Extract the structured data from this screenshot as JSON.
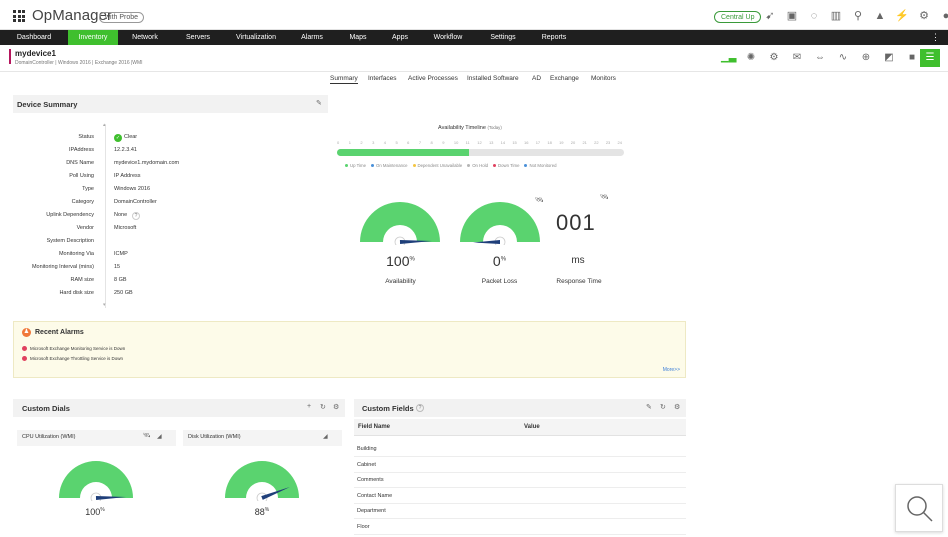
{
  "header": {
    "brand": "OpManager",
    "edition": "with Probe",
    "central_status": "Central Up",
    "icons": [
      "rocket-icon",
      "monitor-icon",
      "lightbulb-icon",
      "gift-icon",
      "search-icon",
      "bell-icon",
      "plug-icon",
      "gear-icon",
      "user-icon"
    ]
  },
  "nav": {
    "items": [
      "Dashboard",
      "Inventory",
      "Network",
      "Servers",
      "Virtualization",
      "Alarms",
      "Maps",
      "Apps",
      "Workflow",
      "Settings",
      "Reports"
    ],
    "active": "Inventory"
  },
  "device": {
    "name": "mydevice1",
    "subtitle": "DomainController | Windows 2016 | Exchange 2016 |WMI"
  },
  "tabs": {
    "items": [
      "Summary",
      "Interfaces",
      "Active Processes",
      "Installed Software",
      "AD",
      "Exchange",
      "Monitors"
    ],
    "active": "Summary"
  },
  "device_summary": {
    "title": "Device Summary",
    "rows": [
      {
        "label": "Status",
        "value": "Clear"
      },
      {
        "label": "IPAddress",
        "value": "12.2.3.41"
      },
      {
        "label": "DNS Name",
        "value": "mydevice1.mydomain.com"
      },
      {
        "label": "Poll Using",
        "value": "IP Address"
      },
      {
        "label": "Type",
        "value": "Windows 2016"
      },
      {
        "label": "Category",
        "value": "DomainController"
      },
      {
        "label": "Uplink Dependency",
        "value": "None"
      },
      {
        "label": "Vendor",
        "value": "Microsoft"
      },
      {
        "label": "System Description",
        "value": ""
      },
      {
        "label": "Monitoring Via",
        "value": "ICMP"
      },
      {
        "label": "Monitoring Interval (mins)",
        "value": "15"
      },
      {
        "label": "RAM size",
        "value": "8 GB"
      },
      {
        "label": "Hard disk size",
        "value": "250 GB"
      }
    ],
    "uplink_help": "?"
  },
  "availability": {
    "title": "Availability Timeline",
    "title_suffix": "(Today)",
    "hours": [
      "0",
      "1",
      "2",
      "3",
      "4",
      "5",
      "6",
      "7",
      "8",
      "9",
      "10",
      "11",
      "12",
      "13",
      "14",
      "15",
      "16",
      "17",
      "18",
      "19",
      "20",
      "21",
      "22",
      "23",
      "24"
    ],
    "up_fraction": 0.46,
    "legend": [
      {
        "label": "Up Time",
        "color": "#5ad36f"
      },
      {
        "label": "On Maintenance",
        "color": "#4a90d9"
      },
      {
        "label": "Dependent Unavailable",
        "color": "#f4c542"
      },
      {
        "label": "On Hold",
        "color": "#b5b5b5"
      },
      {
        "label": "Down Time",
        "color": "#e0415f"
      },
      {
        "label": "Not Monitored",
        "color": "#4a90d9"
      }
    ],
    "availability_value": "100",
    "availability_unit": "%",
    "availability_label": "Availability",
    "packet_loss_value": "0",
    "packet_loss_unit": "%",
    "packet_loss_label": "Packet Loss",
    "response_value": "001",
    "response_unit": "ms",
    "response_label": "Response Time"
  },
  "recent_alarms": {
    "title": "Recent Alarms",
    "items": [
      "Microsoft Exchange Monitoring Service is Down",
      "Microsoft Exchange Throttling Service is Down"
    ],
    "more": "More>>"
  },
  "custom_dials": {
    "title": "Custom Dials",
    "dials": [
      {
        "title": "CPU Utilization (WMI)",
        "value": "100",
        "unit": "%",
        "level": 1.0
      },
      {
        "title": "Disk Utilization (WMI)",
        "value": "88",
        "unit": "%",
        "level": 0.88
      }
    ]
  },
  "custom_fields": {
    "title": "Custom Fields",
    "help": "?",
    "col_name": "Field Name",
    "col_value": "Value",
    "rows": [
      "Building",
      "Cabinet",
      "Comments",
      "Contact Name",
      "Department",
      "Floor"
    ]
  },
  "colors": {
    "accent_green": "#3fbf2e",
    "gauge_green": "#5ad36f",
    "needle": "#1f3f7a",
    "alarm_red": "#e0415f"
  }
}
